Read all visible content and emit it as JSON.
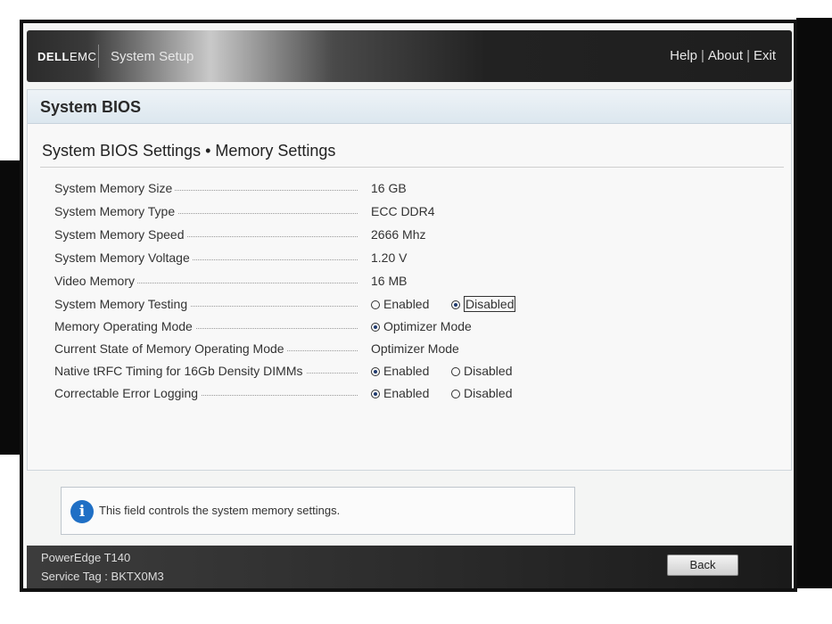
{
  "header": {
    "logo_dell": "DELL",
    "logo_emc": "EMC",
    "title": "System Setup",
    "links": [
      "Help",
      "About",
      "Exit"
    ]
  },
  "section_title": "System BIOS",
  "page_title": "System BIOS Settings • Memory Settings",
  "settings": [
    {
      "label": "System Memory Size",
      "value": "16 GB"
    },
    {
      "label": "System Memory Type",
      "value": "ECC DDR4"
    },
    {
      "label": "System Memory Speed",
      "value": "2666 Mhz"
    },
    {
      "label": "System Memory Voltage",
      "value": "1.20 V"
    },
    {
      "label": "Video Memory",
      "value": "16 MB"
    },
    {
      "label": "System Memory Testing",
      "options": [
        "Enabled",
        "Disabled"
      ],
      "selected": "Disabled"
    },
    {
      "label": "Memory Operating Mode",
      "options": [
        "Optimizer Mode"
      ],
      "selected": "Optimizer Mode"
    },
    {
      "label": "Current State of Memory Operating Mode",
      "value": "Optimizer Mode"
    },
    {
      "label": "Native tRFC Timing for 16Gb Density DIMMs",
      "options": [
        "Enabled",
        "Disabled"
      ],
      "selected": "Enabled"
    },
    {
      "label": "Correctable Error Logging",
      "options": [
        "Enabled",
        "Disabled"
      ],
      "selected": "Enabled"
    }
  ],
  "help": {
    "icon": "info-icon",
    "text": "This field controls the system memory settings."
  },
  "footer": {
    "model": "PowerEdge T140",
    "service_tag": "Service Tag : BKTX0M3",
    "back_label": "Back"
  },
  "colors": {
    "info_icon": "#1f6fc5",
    "radio_selected": "#1f3a6e"
  }
}
